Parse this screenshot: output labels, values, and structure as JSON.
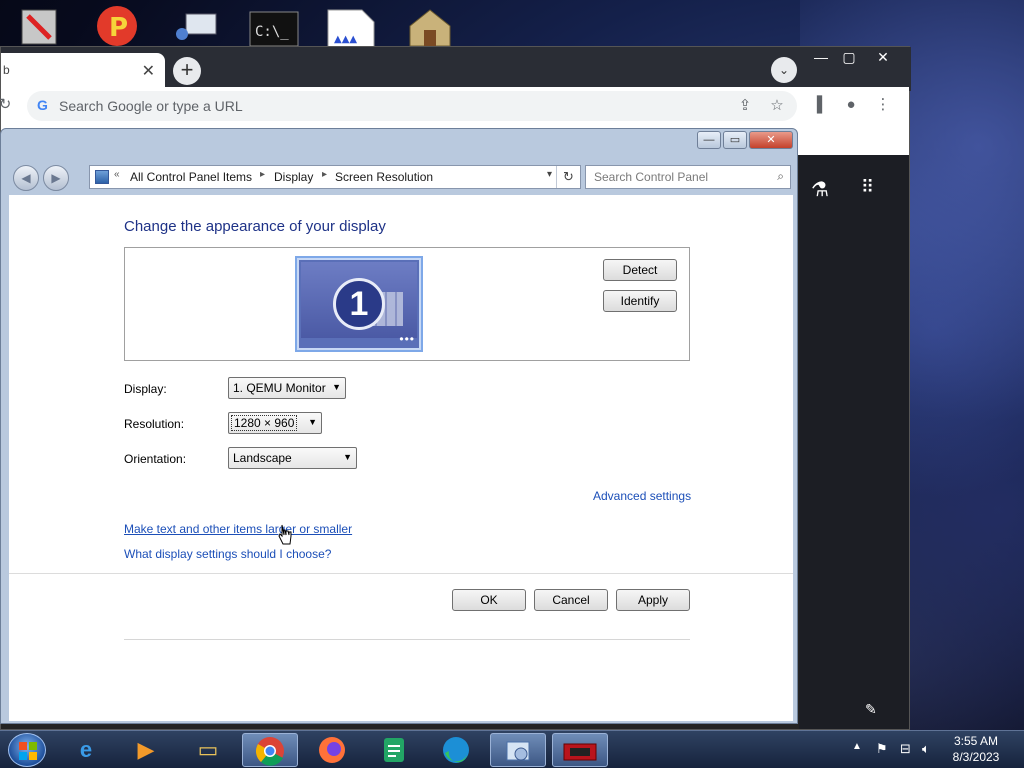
{
  "chrome": {
    "omnibox_placeholder": "Search Google or type a URL",
    "tab_partial_text": "b"
  },
  "control_panel": {
    "breadcrumb": [
      "All Control Panel Items",
      "Display",
      "Screen Resolution"
    ],
    "search_placeholder": "Search Control Panel",
    "heading": "Change the appearance of your display",
    "monitor_number": "1",
    "detect_label": "Detect",
    "identify_label": "Identify",
    "display_label": "Display:",
    "display_value": "1. QEMU Monitor",
    "resolution_label": "Resolution:",
    "resolution_value": "1280 × 960",
    "orientation_label": "Orientation:",
    "orientation_value": "Landscape",
    "advanced_link": "Advanced settings",
    "text_size_link": "Make text and other items larger or smaller",
    "help_link": "What display settings should I choose?",
    "ok_label": "OK",
    "cancel_label": "Cancel",
    "apply_label": "Apply"
  },
  "taskbar": {
    "time": "3:55 AM",
    "date": "8/3/2023"
  }
}
